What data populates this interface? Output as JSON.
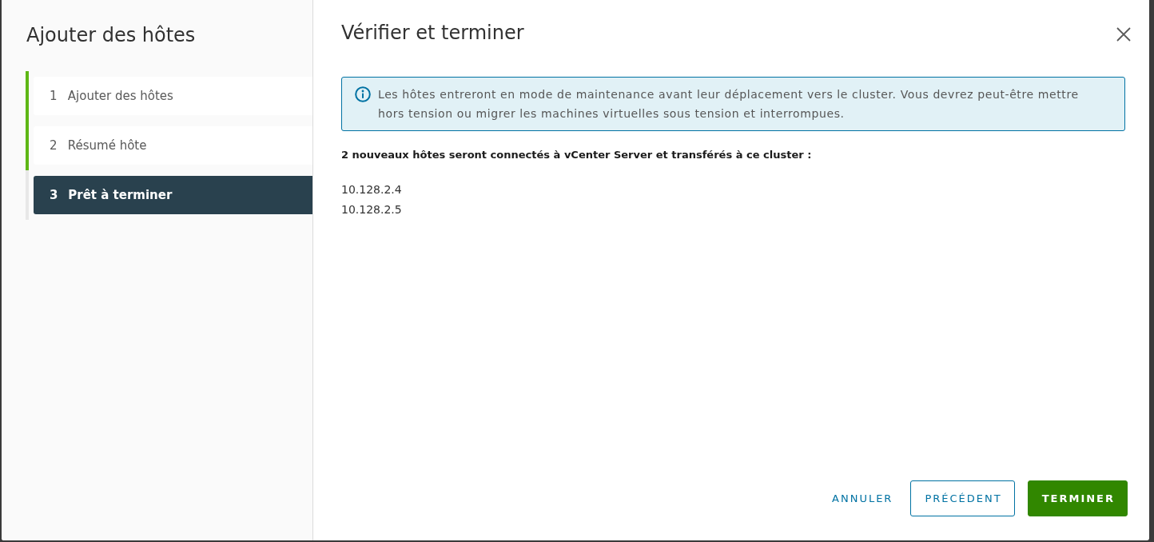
{
  "sidebar": {
    "title": "Ajouter des hôtes",
    "steps": [
      {
        "number": "1",
        "label": "Ajouter des hôtes",
        "completed": true,
        "selected": false
      },
      {
        "number": "2",
        "label": "Résumé hôte",
        "completed": true,
        "selected": false
      },
      {
        "number": "3",
        "label": "Prêt à terminer",
        "completed": false,
        "selected": true
      }
    ]
  },
  "content": {
    "title": "Vérifier et terminer",
    "alert": {
      "kind": "info",
      "text": "Les hôtes entreront en mode de maintenance avant leur déplacement vers le cluster. Vous devrez peut-être mettre hors tension ou migrer les machines virtuelles sous tension et interrompues."
    },
    "summary": "2 nouveaux hôtes seront connectés à vCenter Server et transférés à ce cluster :",
    "hosts": [
      "10.128.2.4",
      "10.128.2.5"
    ]
  },
  "buttons": [
    {
      "label": "ANNULER",
      "kind": "flat"
    },
    {
      "label": "PRÉCÉDENT",
      "kind": "outline"
    },
    {
      "label": "TERMINER",
      "kind": "primary"
    }
  ]
}
